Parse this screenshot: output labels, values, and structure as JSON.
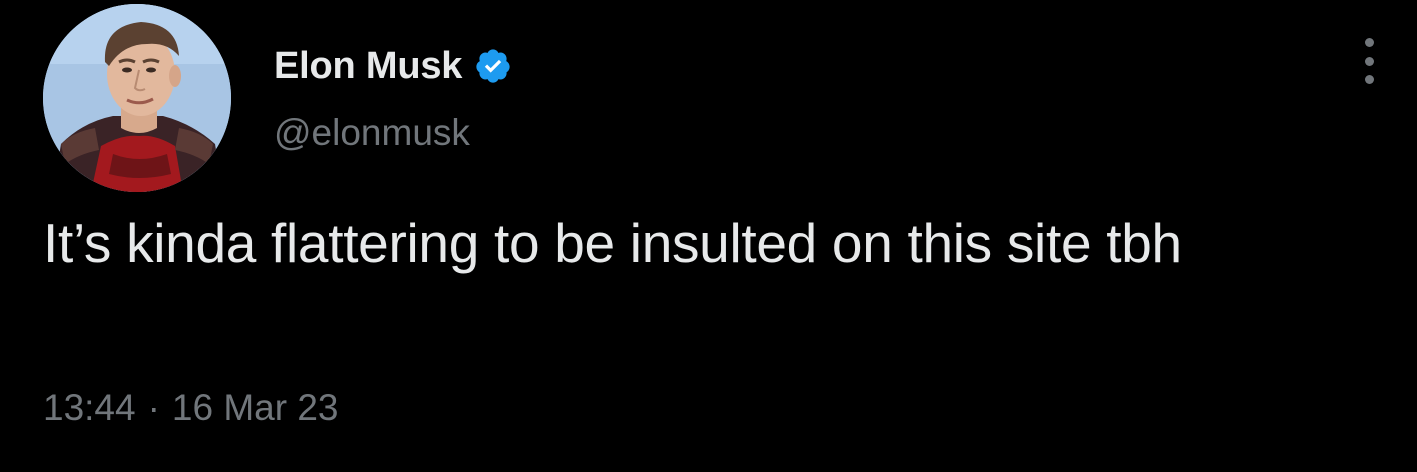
{
  "author": {
    "display_name": "Elon Musk",
    "handle": "@elonmusk",
    "verified": true,
    "verified_icon": "verified-badge-icon",
    "verified_color": "#1d9bf0",
    "avatar": "profile-photo"
  },
  "tweet": {
    "text": "It’s kinda flattering to be insulted on this site tbh",
    "time": "13:44",
    "separator": "·",
    "date": "16 Mar 23"
  },
  "menu": {
    "icon": "more-options-icon"
  },
  "colors": {
    "background": "#000000",
    "primary_text": "#e7e9ea",
    "secondary_text": "#71767b",
    "accent": "#1d9bf0"
  }
}
